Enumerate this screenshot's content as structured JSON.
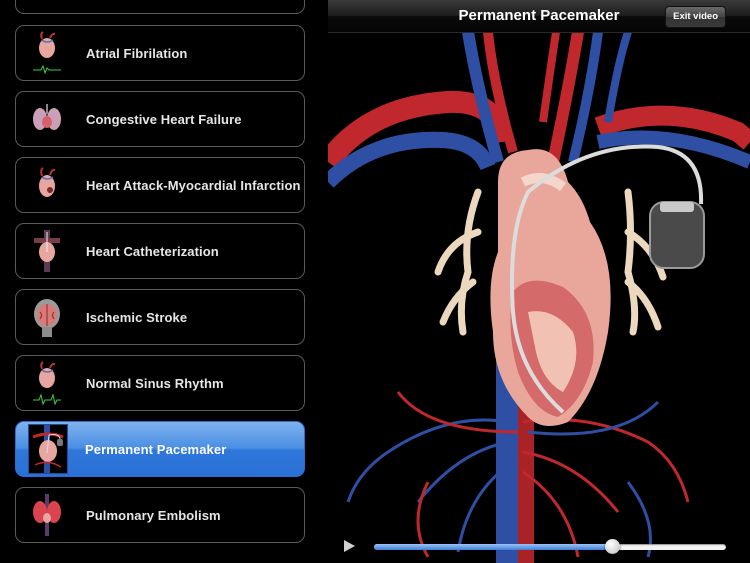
{
  "sidebar": {
    "items": [
      {
        "label": "",
        "icon": "topic-thumbnail-icon",
        "selected": false
      },
      {
        "label": "Atrial Fibrilation",
        "icon": "heart-ecg-icon",
        "selected": false
      },
      {
        "label": "Congestive Heart Failure",
        "icon": "lungs-heart-icon",
        "selected": false
      },
      {
        "label": "Heart Attack-Myocardial Infarction",
        "icon": "heart-icon",
        "selected": false
      },
      {
        "label": "Heart Catheterization",
        "icon": "catheter-heart-icon",
        "selected": false
      },
      {
        "label": "Ischemic Stroke",
        "icon": "brain-icon",
        "selected": false
      },
      {
        "label": "Normal Sinus Rhythm",
        "icon": "heart-ecg-icon",
        "selected": false
      },
      {
        "label": "Permanent Pacemaker",
        "icon": "pacemaker-heart-icon",
        "selected": true
      },
      {
        "label": "Pulmonary Embolism",
        "icon": "lungs-icon",
        "selected": false
      }
    ]
  },
  "video": {
    "title": "Permanent Pacemaker",
    "exit_label": "Exit video",
    "progress": 0.675,
    "colors": {
      "accent": "#3f7fd8",
      "artery": "#c0282d",
      "vein": "#2e4fa3",
      "heart": "#e9a79b"
    }
  }
}
